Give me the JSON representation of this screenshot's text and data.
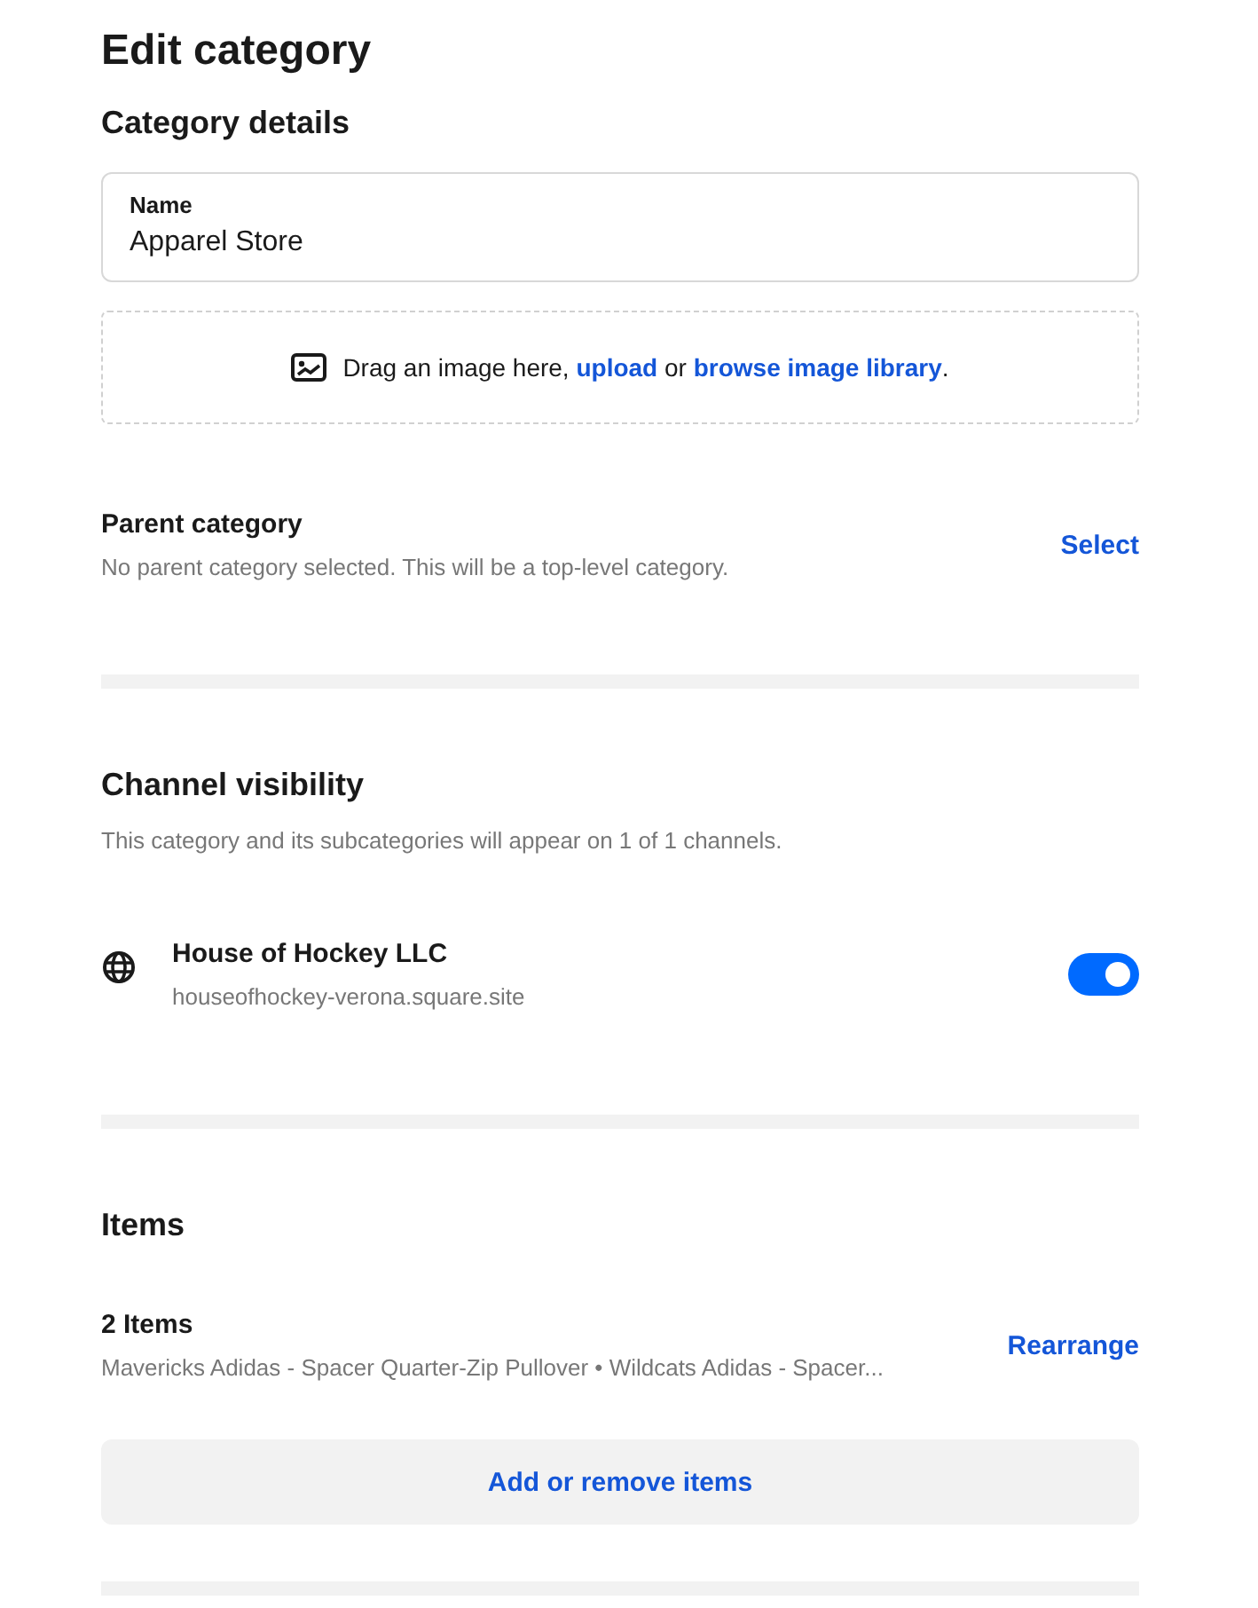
{
  "title": "Edit category",
  "details": {
    "heading": "Category details",
    "name_field": {
      "label": "Name",
      "value": "Apparel Store"
    },
    "image_drop": {
      "parts": [
        {
          "kind": "text",
          "text": "Drag an image here, "
        },
        {
          "kind": "link",
          "text": "upload"
        },
        {
          "kind": "text",
          "text": " or "
        },
        {
          "kind": "link",
          "text": "browse image library"
        },
        {
          "kind": "text",
          "text": "."
        }
      ]
    },
    "parent": {
      "label": "Parent category",
      "description": "No parent category selected. This will be a top-level category.",
      "action": "Select"
    }
  },
  "channel_visibility": {
    "heading": "Channel visibility",
    "description": "This category and its subcategories will appear on 1 of 1 channels.",
    "channels": [
      {
        "name": "House of Hockey LLC",
        "url": "houseofhockey-verona.square.site",
        "on": true
      }
    ]
  },
  "items": {
    "heading": "Items",
    "count": "2 Items",
    "summary": "Mavericks Adidas - Spacer Quarter-Zip Pullover • Wildcats Adidas - Spacer...",
    "action": "Rearrange",
    "button": "Add or remove items"
  }
}
